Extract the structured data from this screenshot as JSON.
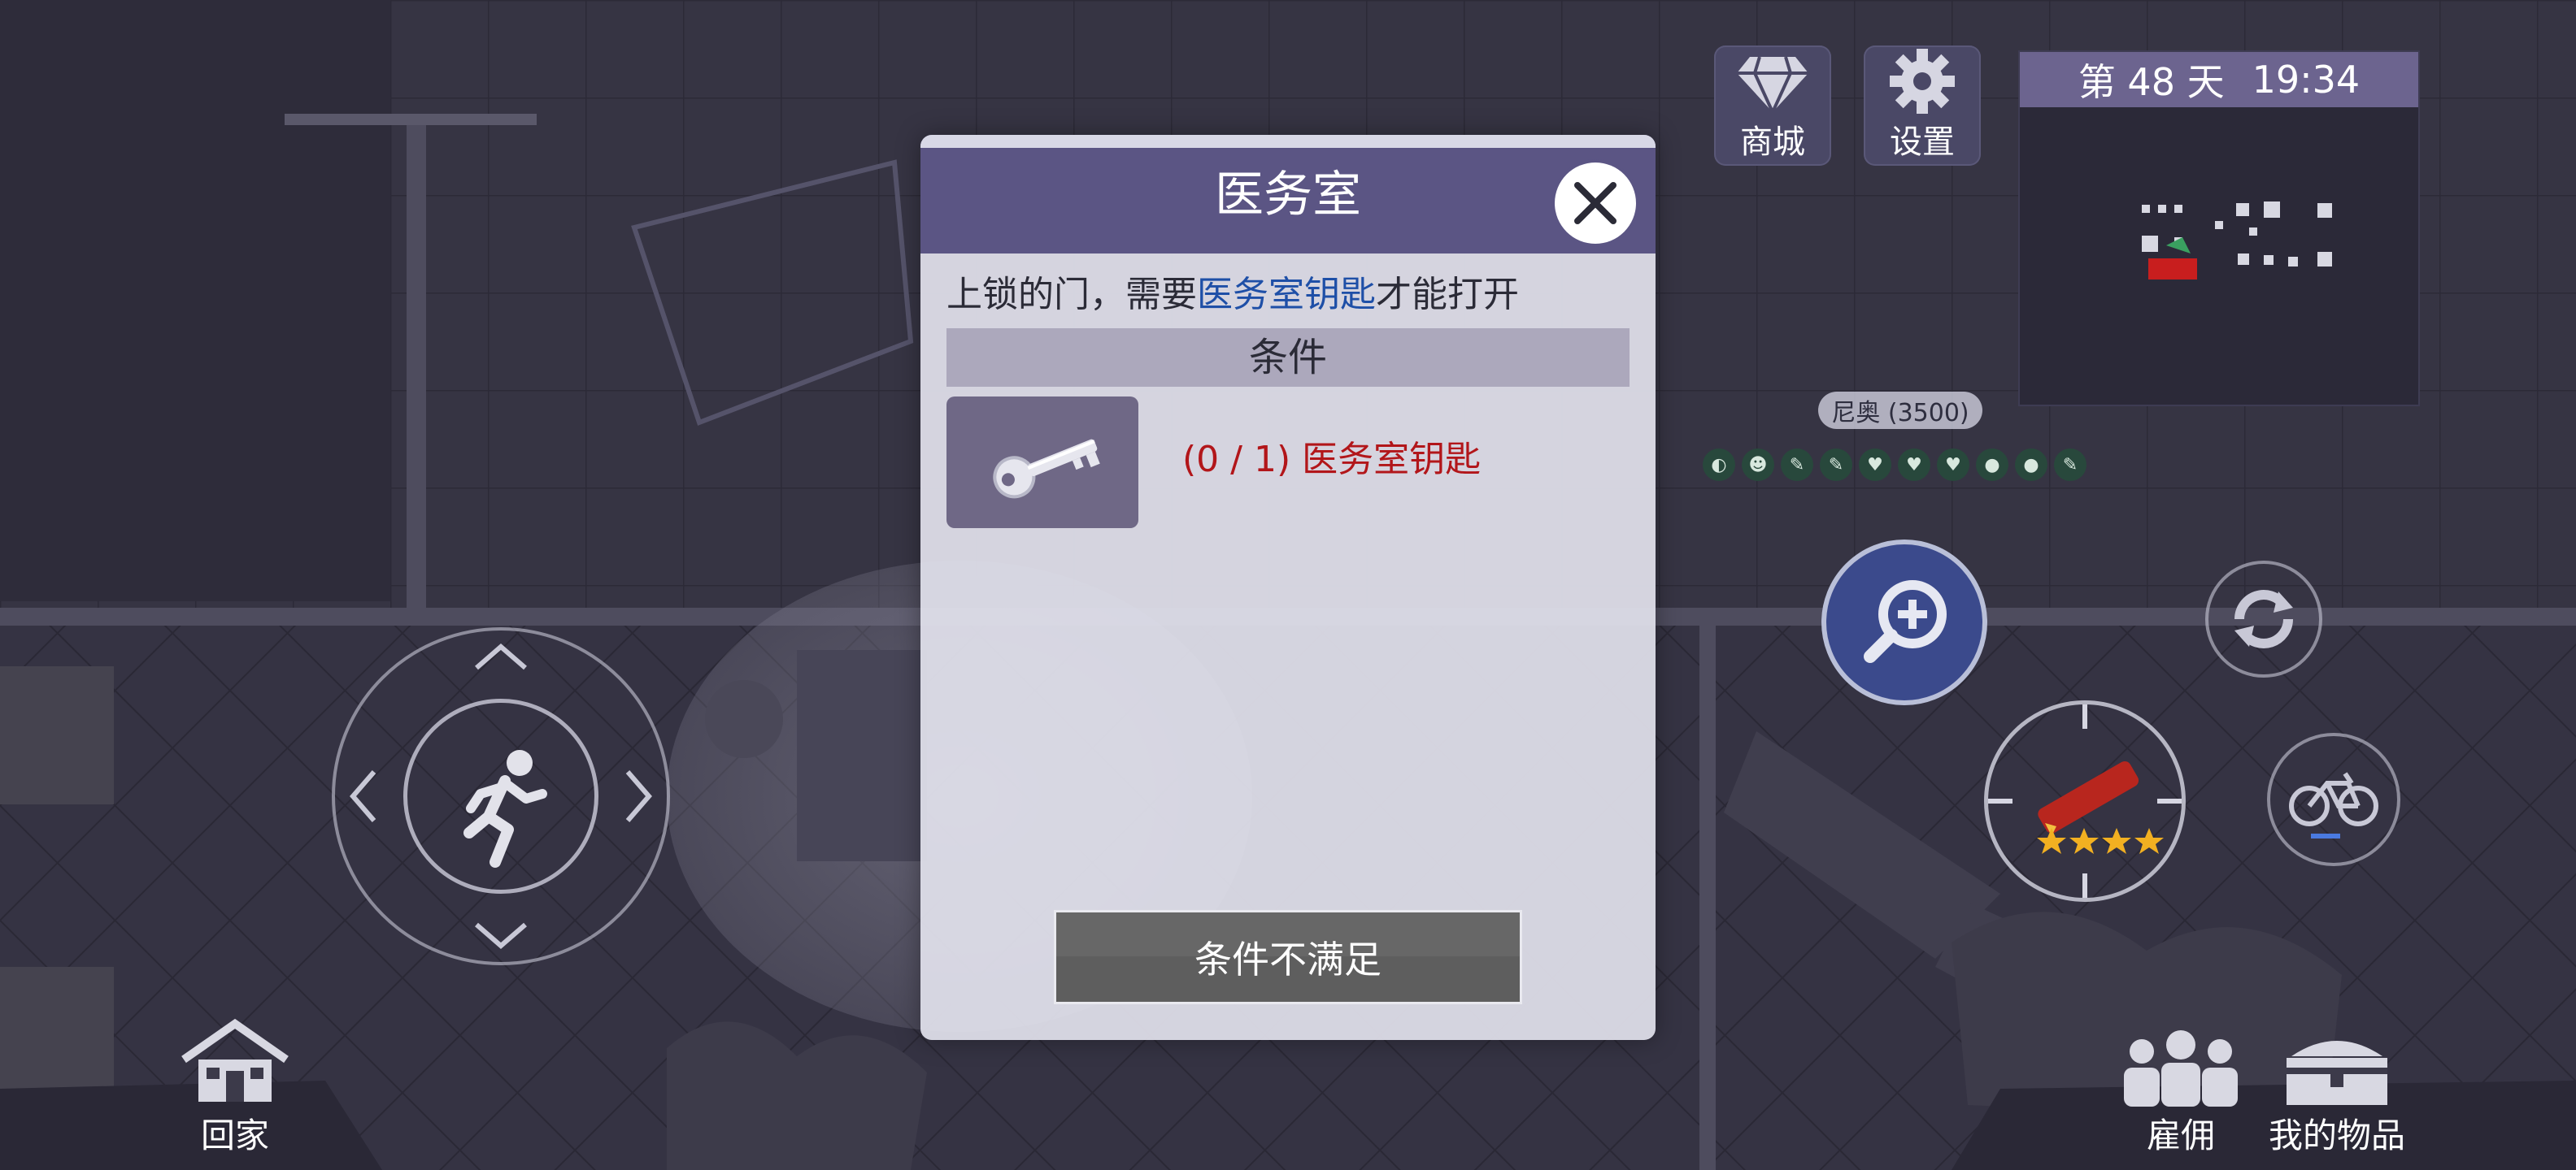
{
  "hud": {
    "shop_label": "商城",
    "settings_label": "设置",
    "day_prefix": "第 48 天",
    "time": "19:34",
    "npc_name": "尼奥 (3500)",
    "home_label": "回家",
    "hire_label": "雇佣",
    "items_label": "我的物品"
  },
  "dialog": {
    "title": "医务室",
    "desc_before": "上锁的门，需要",
    "desc_highlight": "医务室钥匙",
    "desc_after": "才能打开",
    "conditions_header": "条件",
    "requirement_text": "(0 / 1) 医务室钥匙",
    "action_button_label": "条件不满足"
  },
  "icons": {
    "shop": "diamond-icon",
    "settings": "gear-icon",
    "close": "close-icon",
    "key": "key-icon",
    "zoom": "zoom-in-icon",
    "refresh": "refresh-icon",
    "run": "running-man-icon",
    "bike": "bicycle-icon",
    "home": "house-icon",
    "hire": "people-icon",
    "items": "chest-icon"
  },
  "colors": {
    "dialog_header": "#5b5584",
    "requirement_unmet": "#b2161a",
    "highlight": "#1e4fa7"
  }
}
